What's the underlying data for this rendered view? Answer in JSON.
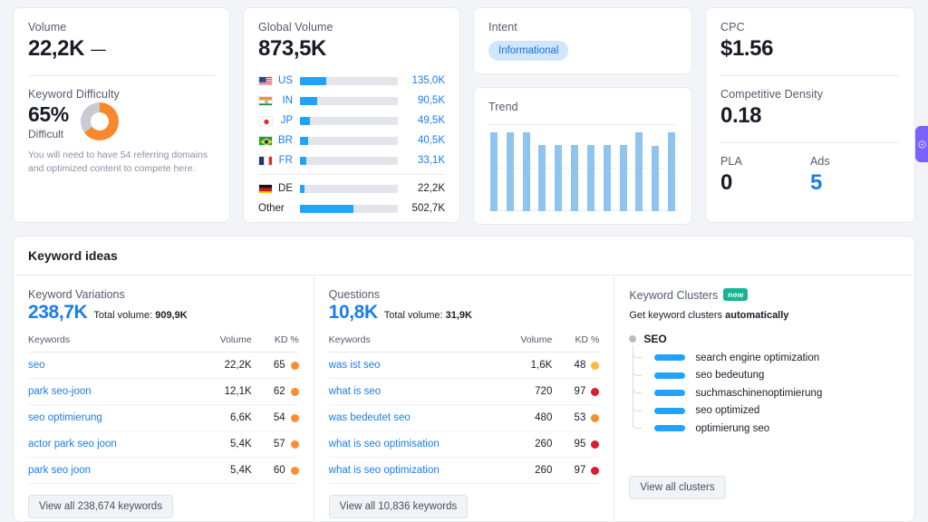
{
  "volume_card": {
    "label": "Volume",
    "value": "22,2K",
    "flag": "de-flag",
    "difficulty_label": "Keyword Difficulty",
    "difficulty_value": "65%",
    "difficulty_sub": "Difficult",
    "difficulty_note": "You will need to have 54 referring domains and optimized content to compete here.",
    "difficulty_percent": 65,
    "difficulty_color": "#f8882b",
    "difficulty_track_color": "#c8cbd4"
  },
  "global_volume": {
    "label": "Global Volume",
    "value": "873,5K",
    "rows": [
      {
        "code": "US",
        "flag": "us-flag",
        "value": "135,0K",
        "pct": 27
      },
      {
        "code": "IN",
        "flag": "in-flag",
        "value": "90,5K",
        "pct": 18
      },
      {
        "code": "JP",
        "flag": "jp-flag",
        "value": "49,5K",
        "pct": 10
      },
      {
        "code": "BR",
        "flag": "br-flag",
        "value": "40,5K",
        "pct": 8
      },
      {
        "code": "FR",
        "flag": "fr-flag",
        "value": "33,1K",
        "pct": 6.5
      }
    ],
    "rows_secondary": [
      {
        "code": "DE",
        "flag": "de-flag",
        "value": "22,2K",
        "pct": 4.4
      },
      {
        "code": "Other",
        "flag": "",
        "value": "502,7K",
        "pct": 55
      }
    ]
  },
  "intent_card": {
    "label": "Intent",
    "badge": "Informational"
  },
  "trend_card": {
    "label": "Trend"
  },
  "cpc_card": {
    "cpc_label": "CPC",
    "cpc_value": "$1.56",
    "density_label": "Competitive Density",
    "density_value": "0.18",
    "pla_label": "PLA",
    "pla_value": "0",
    "ads_label": "Ads",
    "ads_value": "5"
  },
  "keyword_ideas": {
    "title": "Keyword ideas",
    "variations": {
      "title": "Keyword Variations",
      "count": "238,7K",
      "total_label": "Total volume:",
      "total_value": "909,9K",
      "columns": {
        "keyword": "Keywords",
        "volume": "Volume",
        "kd": "KD %"
      },
      "rows": [
        {
          "keyword": "seo",
          "volume": "22,2K",
          "kd": "65",
          "color": "#ff8c2e"
        },
        {
          "keyword": "park seo-joon",
          "volume": "12,1K",
          "kd": "62",
          "color": "#ff8c2e"
        },
        {
          "keyword": "seo optimierung",
          "volume": "6,6K",
          "kd": "54",
          "color": "#ff8c2e"
        },
        {
          "keyword": "actor park seo joon",
          "volume": "5,4K",
          "kd": "57",
          "color": "#ff8c2e"
        },
        {
          "keyword": "park seo joon",
          "volume": "5,4K",
          "kd": "60",
          "color": "#ff8c2e"
        }
      ],
      "button": "View all 238,674 keywords"
    },
    "questions": {
      "title": "Questions",
      "count": "10,8K",
      "total_label": "Total volume:",
      "total_value": "31,9K",
      "columns": {
        "keyword": "Keywords",
        "volume": "Volume",
        "kd": "KD %"
      },
      "rows": [
        {
          "keyword": "was ist seo",
          "volume": "1,6K",
          "kd": "48",
          "color": "#ffb93c"
        },
        {
          "keyword": "what is seo",
          "volume": "720",
          "kd": "97",
          "color": "#d91c2e"
        },
        {
          "keyword": "was bedeutet seo",
          "volume": "480",
          "kd": "53",
          "color": "#fa8c2e"
        },
        {
          "keyword": "what is seo optimisation",
          "volume": "260",
          "kd": "95",
          "color": "#d91c2e"
        },
        {
          "keyword": "what is seo optimization",
          "volume": "260",
          "kd": "97",
          "color": "#d91c2e"
        }
      ],
      "button": "View all 10,836 keywords"
    },
    "clusters": {
      "title": "Keyword Clusters",
      "badge": "new",
      "subtitle_prefix": "Get keyword clusters ",
      "subtitle_strong": "automatically",
      "root": "SEO",
      "items": [
        "search engine optimization",
        "seo bedeutung",
        "suchmaschinenoptimierung",
        "seo optimized",
        "optimierung seo"
      ],
      "button": "View all clusters"
    }
  },
  "chart_data": [
    {
      "type": "bar",
      "title": "Trend",
      "categories": [
        "1",
        "2",
        "3",
        "4",
        "5",
        "6",
        "7",
        "8",
        "9",
        "10",
        "11",
        "12"
      ],
      "values": [
        100,
        100,
        100,
        84,
        84,
        84,
        84,
        84,
        84,
        100,
        83,
        100
      ],
      "ylim": [
        0,
        110
      ],
      "grid": true,
      "xlabel": "",
      "ylabel": "",
      "series_color": "#8fc4ef"
    },
    {
      "type": "bar",
      "title": "Global Volume",
      "categories": [
        "US",
        "IN",
        "JP",
        "BR",
        "FR",
        "DE",
        "Other"
      ],
      "values": [
        135000,
        90500,
        49500,
        40500,
        33100,
        22200,
        502700
      ],
      "value_labels": [
        "135,0K",
        "90,5K",
        "49,5K",
        "40,5K",
        "33,1K",
        "22,2K",
        "502,7K"
      ],
      "ylabel": "Volume",
      "series_color": "#22a3fb"
    },
    {
      "type": "pie",
      "title": "Keyword Difficulty",
      "categories": [
        "Difficult",
        "Remaining"
      ],
      "values": [
        65,
        35
      ],
      "colors": [
        "#f8882b",
        "#c8cbd4"
      ]
    }
  ],
  "side_tab": {
    "icon": "chat-bubble-icon",
    "color": "#7b61ff"
  }
}
